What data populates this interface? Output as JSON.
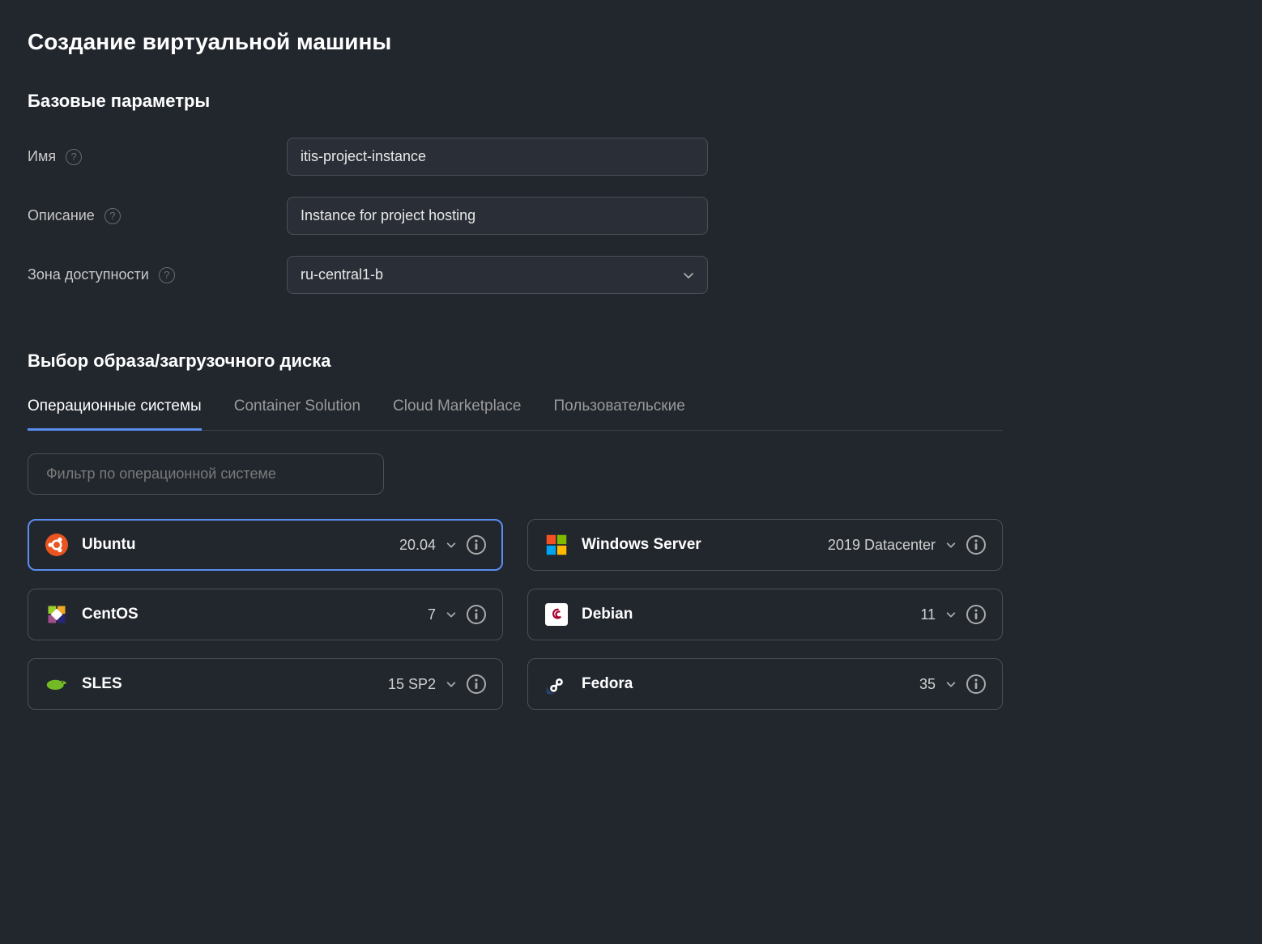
{
  "page": {
    "title": "Создание виртуальной машины"
  },
  "basic": {
    "heading": "Базовые параметры",
    "name_label": "Имя",
    "name_value": "itis-project-instance",
    "desc_label": "Описание",
    "desc_value": "Instance for project hosting",
    "zone_label": "Зона доступности",
    "zone_value": "ru-central1-b"
  },
  "image": {
    "heading": "Выбор образа/загрузочного диска",
    "tabs": {
      "os": "Операционные системы",
      "container": "Container Solution",
      "marketplace": "Cloud Marketplace",
      "custom": "Пользовательские"
    },
    "filter_placeholder": "Фильтр по операционной системе",
    "os_list": [
      {
        "name": "Ubuntu",
        "version": "20.04",
        "selected": true
      },
      {
        "name": "Windows Server",
        "version": "2019 Datacenter",
        "selected": false
      },
      {
        "name": "CentOS",
        "version": "7",
        "selected": false
      },
      {
        "name": "Debian",
        "version": "11",
        "selected": false
      },
      {
        "name": "SLES",
        "version": "15 SP2",
        "selected": false
      },
      {
        "name": "Fedora",
        "version": "35",
        "selected": false
      }
    ]
  }
}
